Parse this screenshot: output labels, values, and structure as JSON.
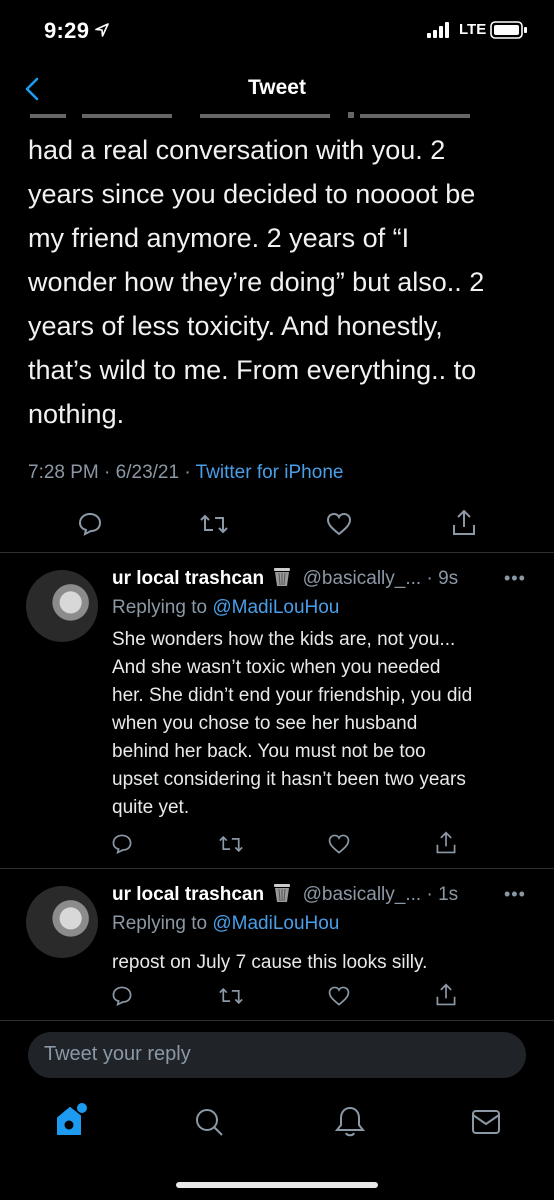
{
  "status_bar": {
    "time": "9:29",
    "network": "LTE"
  },
  "header": {
    "title": "Tweet"
  },
  "tweet": {
    "body": "had a real conversation with you. 2\nyears since you decided to noooot be\nmy friend anymore. 2 years of “I\nwonder how they’re doing” but also.. 2\nyears of less toxicity. And honestly,\nthat’s wild to me. From everything.. to\nnothing.",
    "time": "7:28 PM",
    "date": "6/23/21",
    "separator": "·",
    "source": "Twitter for iPhone"
  },
  "replies": [
    {
      "name": "ur local trashcan",
      "handle": "@basically_...",
      "age": "· 9s",
      "replying_label": "Replying to",
      "replying_to": "@MadiLouHou",
      "text": "She wonders how the kids are, not you...\nAnd she wasn’t toxic when you needed\nher. She didn’t end your friendship, you did\nwhen you chose to see her husband\nbehind her back. You must not be too\nupset considering it hasn’t been two years\nquite yet."
    },
    {
      "name": "ur local trashcan",
      "handle": "@basically_...",
      "age": "· 1s",
      "replying_label": "Replying to",
      "replying_to": "@MadiLouHou",
      "text": "repost on July 7 cause this looks silly."
    }
  ],
  "composer": {
    "placeholder": "Tweet your reply"
  },
  "more_label": "•••",
  "colors": {
    "background": "#000000",
    "link": "#4a9ee8",
    "muted": "#8b98a5",
    "home_active": "#1d9bf0"
  },
  "icons": {
    "tweet_actions": [
      "reply-icon",
      "retweet-icon",
      "like-icon",
      "share-icon"
    ],
    "tabs": [
      "home-icon",
      "search-icon",
      "notifications-icon",
      "messages-icon"
    ]
  }
}
